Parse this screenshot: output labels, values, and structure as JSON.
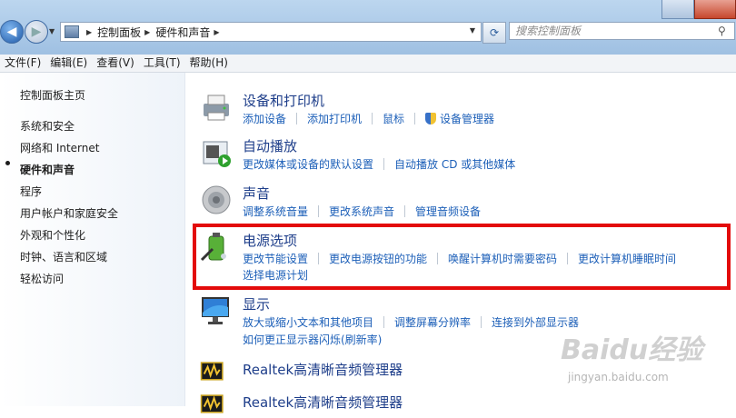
{
  "address_bar": {
    "crumbs": [
      "控制面板",
      "硬件和声音"
    ],
    "search_placeholder": "搜索控制面板"
  },
  "menu": [
    "文件(F)",
    "编辑(E)",
    "查看(V)",
    "工具(T)",
    "帮助(H)"
  ],
  "sidebar": {
    "items": [
      {
        "label": "控制面板主页"
      },
      {
        "label": "系统和安全"
      },
      {
        "label": "网络和 Internet"
      },
      {
        "label": "硬件和声音",
        "active": true
      },
      {
        "label": "程序"
      },
      {
        "label": "用户帐户和家庭安全"
      },
      {
        "label": "外观和个性化"
      },
      {
        "label": "时钟、语言和区域"
      },
      {
        "label": "轻松访问"
      }
    ]
  },
  "categories": [
    {
      "title": "设备和打印机",
      "icon": "printer-icon",
      "rows": [
        [
          "添加设备",
          "添加打印机",
          "鼠标",
          "设备管理器"
        ]
      ]
    },
    {
      "title": "自动播放",
      "icon": "autoplay-icon",
      "rows": [
        [
          "更改媒体或设备的默认设置",
          "自动播放 CD 或其他媒体"
        ]
      ]
    },
    {
      "title": "声音",
      "icon": "speaker-icon",
      "rows": [
        [
          "调整系统音量",
          "更改系统声音",
          "管理音频设备"
        ]
      ]
    },
    {
      "title": "电源选项",
      "icon": "battery-icon",
      "rows": [
        [
          "更改节能设置",
          "更改电源按钮的功能",
          "唤醒计算机时需要密码",
          "更改计算机睡眠时间"
        ],
        [
          "选择电源计划"
        ]
      ]
    },
    {
      "title": "显示",
      "icon": "monitor-icon",
      "rows": [
        [
          "放大或缩小文本和其他项目",
          "调整屏幕分辨率",
          "连接到外部显示器"
        ],
        [
          "如何更正显示器闪烁(刷新率)"
        ]
      ]
    },
    {
      "title": "Realtek高清晰音频管理器",
      "icon": "realtek-icon",
      "rows": []
    },
    {
      "title": "Realtek高清晰音频管理器",
      "icon": "realtek-icon",
      "rows": []
    }
  ],
  "highlight_color": "#e30b0b",
  "watermark": {
    "logo": "Baidu经验",
    "sub": "jingyan.baidu.com"
  }
}
